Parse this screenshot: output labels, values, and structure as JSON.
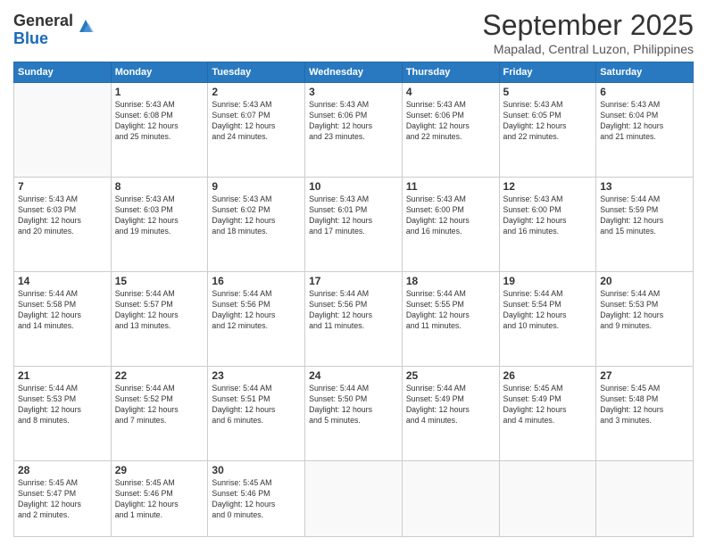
{
  "header": {
    "logo": {
      "line1": "General",
      "line2": "Blue"
    },
    "title": "September 2025",
    "location": "Mapalad, Central Luzon, Philippines"
  },
  "calendar": {
    "days_of_week": [
      "Sunday",
      "Monday",
      "Tuesday",
      "Wednesday",
      "Thursday",
      "Friday",
      "Saturday"
    ],
    "weeks": [
      [
        {
          "day": "",
          "info": ""
        },
        {
          "day": "1",
          "info": "Sunrise: 5:43 AM\nSunset: 6:08 PM\nDaylight: 12 hours\nand 25 minutes."
        },
        {
          "day": "2",
          "info": "Sunrise: 5:43 AM\nSunset: 6:07 PM\nDaylight: 12 hours\nand 24 minutes."
        },
        {
          "day": "3",
          "info": "Sunrise: 5:43 AM\nSunset: 6:06 PM\nDaylight: 12 hours\nand 23 minutes."
        },
        {
          "day": "4",
          "info": "Sunrise: 5:43 AM\nSunset: 6:06 PM\nDaylight: 12 hours\nand 22 minutes."
        },
        {
          "day": "5",
          "info": "Sunrise: 5:43 AM\nSunset: 6:05 PM\nDaylight: 12 hours\nand 22 minutes."
        },
        {
          "day": "6",
          "info": "Sunrise: 5:43 AM\nSunset: 6:04 PM\nDaylight: 12 hours\nand 21 minutes."
        }
      ],
      [
        {
          "day": "7",
          "info": "Sunrise: 5:43 AM\nSunset: 6:03 PM\nDaylight: 12 hours\nand 20 minutes."
        },
        {
          "day": "8",
          "info": "Sunrise: 5:43 AM\nSunset: 6:03 PM\nDaylight: 12 hours\nand 19 minutes."
        },
        {
          "day": "9",
          "info": "Sunrise: 5:43 AM\nSunset: 6:02 PM\nDaylight: 12 hours\nand 18 minutes."
        },
        {
          "day": "10",
          "info": "Sunrise: 5:43 AM\nSunset: 6:01 PM\nDaylight: 12 hours\nand 17 minutes."
        },
        {
          "day": "11",
          "info": "Sunrise: 5:43 AM\nSunset: 6:00 PM\nDaylight: 12 hours\nand 16 minutes."
        },
        {
          "day": "12",
          "info": "Sunrise: 5:43 AM\nSunset: 6:00 PM\nDaylight: 12 hours\nand 16 minutes."
        },
        {
          "day": "13",
          "info": "Sunrise: 5:44 AM\nSunset: 5:59 PM\nDaylight: 12 hours\nand 15 minutes."
        }
      ],
      [
        {
          "day": "14",
          "info": "Sunrise: 5:44 AM\nSunset: 5:58 PM\nDaylight: 12 hours\nand 14 minutes."
        },
        {
          "day": "15",
          "info": "Sunrise: 5:44 AM\nSunset: 5:57 PM\nDaylight: 12 hours\nand 13 minutes."
        },
        {
          "day": "16",
          "info": "Sunrise: 5:44 AM\nSunset: 5:56 PM\nDaylight: 12 hours\nand 12 minutes."
        },
        {
          "day": "17",
          "info": "Sunrise: 5:44 AM\nSunset: 5:56 PM\nDaylight: 12 hours\nand 11 minutes."
        },
        {
          "day": "18",
          "info": "Sunrise: 5:44 AM\nSunset: 5:55 PM\nDaylight: 12 hours\nand 11 minutes."
        },
        {
          "day": "19",
          "info": "Sunrise: 5:44 AM\nSunset: 5:54 PM\nDaylight: 12 hours\nand 10 minutes."
        },
        {
          "day": "20",
          "info": "Sunrise: 5:44 AM\nSunset: 5:53 PM\nDaylight: 12 hours\nand 9 minutes."
        }
      ],
      [
        {
          "day": "21",
          "info": "Sunrise: 5:44 AM\nSunset: 5:53 PM\nDaylight: 12 hours\nand 8 minutes."
        },
        {
          "day": "22",
          "info": "Sunrise: 5:44 AM\nSunset: 5:52 PM\nDaylight: 12 hours\nand 7 minutes."
        },
        {
          "day": "23",
          "info": "Sunrise: 5:44 AM\nSunset: 5:51 PM\nDaylight: 12 hours\nand 6 minutes."
        },
        {
          "day": "24",
          "info": "Sunrise: 5:44 AM\nSunset: 5:50 PM\nDaylight: 12 hours\nand 5 minutes."
        },
        {
          "day": "25",
          "info": "Sunrise: 5:44 AM\nSunset: 5:49 PM\nDaylight: 12 hours\nand 4 minutes."
        },
        {
          "day": "26",
          "info": "Sunrise: 5:45 AM\nSunset: 5:49 PM\nDaylight: 12 hours\nand 4 minutes."
        },
        {
          "day": "27",
          "info": "Sunrise: 5:45 AM\nSunset: 5:48 PM\nDaylight: 12 hours\nand 3 minutes."
        }
      ],
      [
        {
          "day": "28",
          "info": "Sunrise: 5:45 AM\nSunset: 5:47 PM\nDaylight: 12 hours\nand 2 minutes."
        },
        {
          "day": "29",
          "info": "Sunrise: 5:45 AM\nSunset: 5:46 PM\nDaylight: 12 hours\nand 1 minute."
        },
        {
          "day": "30",
          "info": "Sunrise: 5:45 AM\nSunset: 5:46 PM\nDaylight: 12 hours\nand 0 minutes."
        },
        {
          "day": "",
          "info": ""
        },
        {
          "day": "",
          "info": ""
        },
        {
          "day": "",
          "info": ""
        },
        {
          "day": "",
          "info": ""
        }
      ]
    ]
  }
}
